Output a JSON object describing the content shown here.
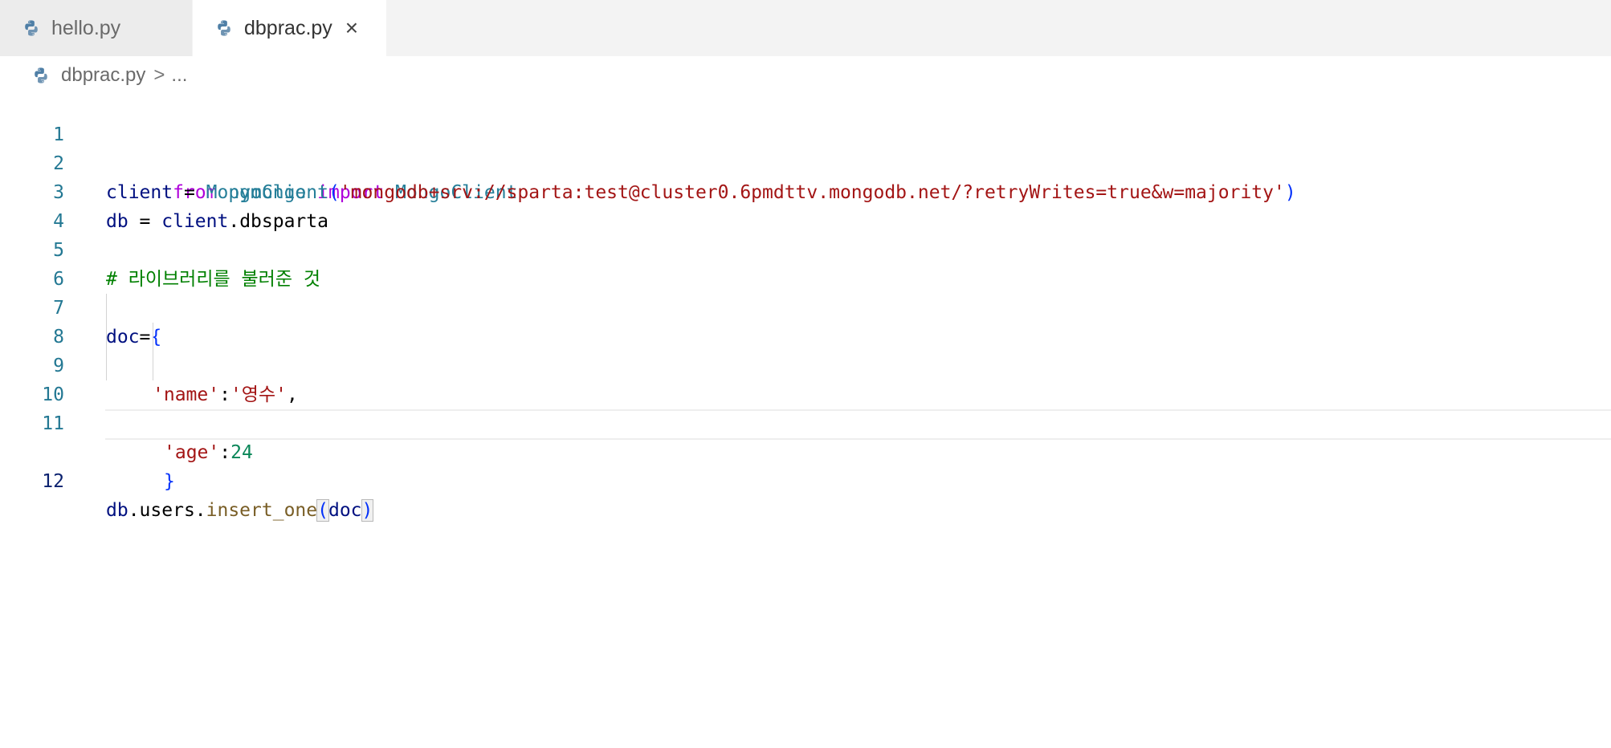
{
  "tabs": [
    {
      "label": "hello.py",
      "active": false
    },
    {
      "label": "dbprac.py",
      "active": true
    }
  ],
  "close_glyph": "×",
  "breadcrumb": {
    "file": "dbprac.py",
    "separator": ">",
    "rest": "..."
  },
  "line_numbers": [
    "1",
    "2",
    "3",
    "4",
    "5",
    "6",
    "7",
    "8",
    "9",
    "10",
    "11",
    "12"
  ],
  "current_line": 12,
  "code": {
    "l1": {
      "kw1": "from",
      "mod": "pymongo",
      "kw2": "import",
      "cls": "MongoClient"
    },
    "l2": {
      "var": "client",
      "eq": " = ",
      "cls": "MongoClient",
      "open": "(",
      "str": "'mongodb+srv://sparta:test@cluster0.6pmdttv.mongodb.net/?retryWrites=true&w=majority'",
      "close": ")"
    },
    "l3": {
      "var1": "db",
      "eq": " = ",
      "var2": "client",
      "rest": ".dbsparta"
    },
    "l5": {
      "comment": "# 라이브러리를 불러준 것"
    },
    "l7": {
      "var": "doc",
      "eq": "=",
      "brace": "{"
    },
    "l8": {
      "key": "'name'",
      "colon": ":",
      "val": "'영수'",
      "comma": ","
    },
    "l9": {
      "key": "'age'",
      "colon": ":",
      "num": "24"
    },
    "l10": {
      "brace": "}"
    },
    "l12": {
      "var1": "db",
      "rest": ".users.",
      "fn": "insert_one",
      "open": "(",
      "arg": "doc",
      "close": ")"
    }
  },
  "colors": {
    "keyword": "#af00db",
    "class": "#267f99",
    "variable": "#001080",
    "string": "#a31515",
    "number": "#098658",
    "comment": "#008000",
    "function": "#795e26",
    "line_number": "#237893"
  },
  "icons": {
    "tab_icon": "python-icon",
    "close": "close-icon"
  }
}
